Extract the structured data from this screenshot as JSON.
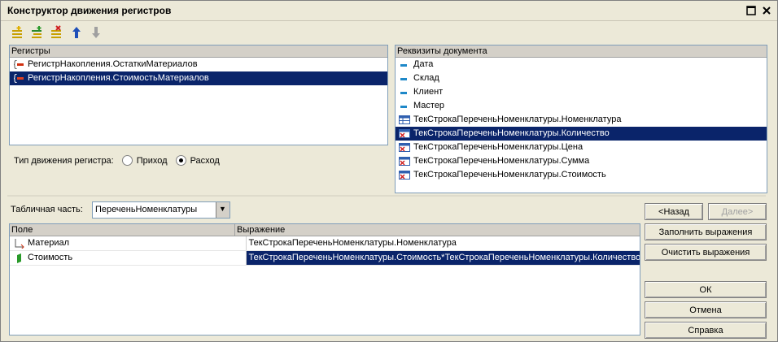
{
  "window": {
    "title": "Конструктор движения регистров"
  },
  "registers_panel": {
    "header": "Регистры",
    "items": [
      {
        "label": "РегистрНакопления.ОстаткиМатериалов",
        "selected": false
      },
      {
        "label": "РегистрНакопления.СтоимостьМатериалов",
        "selected": true
      }
    ]
  },
  "movement_type": {
    "label": "Тип движения регистра:",
    "options": [
      {
        "label": "Приход",
        "checked": false
      },
      {
        "label": "Расход",
        "checked": true
      }
    ]
  },
  "attributes_panel": {
    "header": "Реквизиты документа",
    "items": [
      {
        "label": "Дата",
        "icon": "attribute-icon"
      },
      {
        "label": "Склад",
        "icon": "attribute-icon"
      },
      {
        "label": "Клиент",
        "icon": "attribute-icon"
      },
      {
        "label": "Мастер",
        "icon": "attribute-icon"
      },
      {
        "label": "ТекСтрокаПереченьНоменклатуры.Номенклатура",
        "icon": "table-attribute-icon"
      },
      {
        "label": "ТекСтрокаПереченьНоменклатуры.Количество",
        "icon": "table-attribute-icon",
        "selected": true
      },
      {
        "label": "ТекСтрокаПереченьНоменклатуры.Цена",
        "icon": "table-attribute-icon"
      },
      {
        "label": "ТекСтрокаПереченьНоменклатуры.Сумма",
        "icon": "table-attribute-icon"
      },
      {
        "label": "ТекСтрокаПереченьНоменклатуры.Стоимость",
        "icon": "table-attribute-icon"
      }
    ]
  },
  "tabular_part": {
    "label": "Табличная часть:",
    "value": "ПереченьНоменклатуры"
  },
  "fields_grid": {
    "columns": [
      "Поле",
      "Выражение"
    ],
    "rows": [
      {
        "field": "Материал",
        "expression": "ТекСтрокаПереченьНоменклатуры.Номенклатура",
        "icon": "dimension-icon"
      },
      {
        "field": "Стоимость",
        "expression": "ТекСтрокаПереченьНоменклатуры.Стоимость*ТекСтрокаПереченьНоменклатуры.Количество",
        "icon": "resource-icon",
        "selected": true
      }
    ]
  },
  "buttons": {
    "back": "<Назад",
    "next": "Далее>",
    "fill": "Заполнить выражения",
    "clear": "Очистить выражения",
    "ok": "ОК",
    "cancel": "Отмена",
    "help": "Справка"
  },
  "colors": {
    "selection": "#0a246a",
    "window_bg": "#ece9d8"
  }
}
